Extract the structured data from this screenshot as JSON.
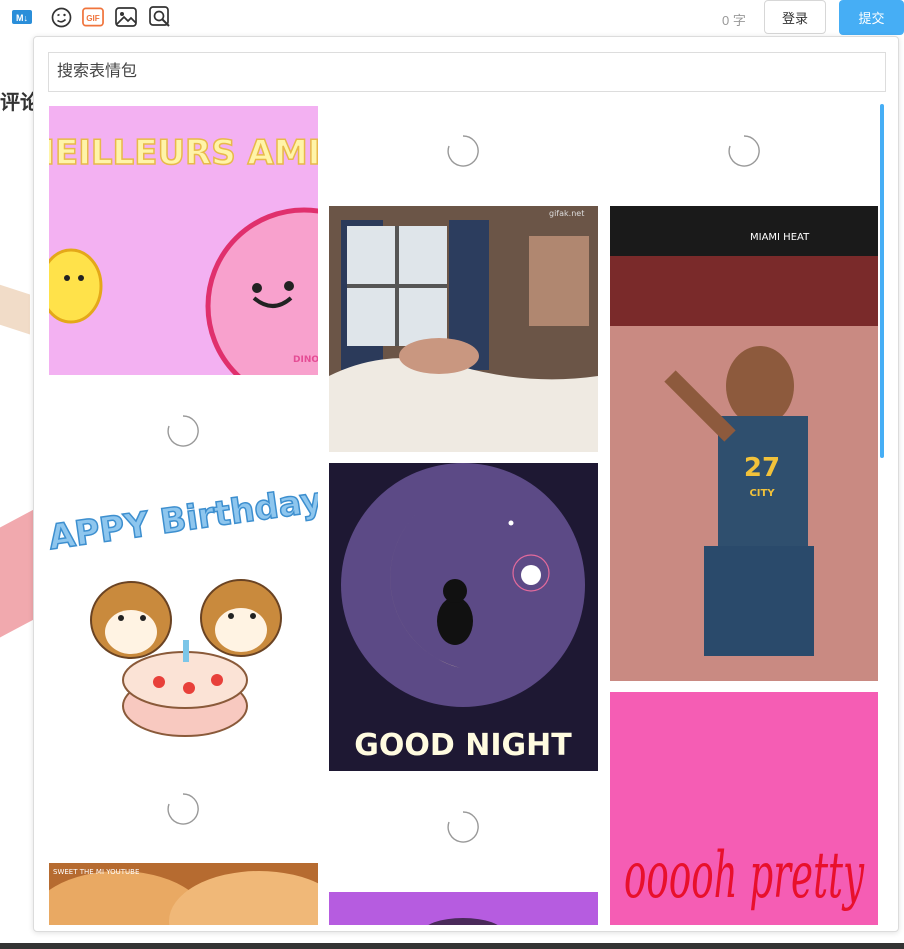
{
  "page": {
    "comment_heading": "评论"
  },
  "toolbar": {
    "icons": [
      "markdown-icon",
      "emoji-icon",
      "gif-icon",
      "image-icon",
      "search-image-icon"
    ],
    "word_count": "0",
    "word_unit": "字",
    "login_label": "登录",
    "submit_label": "提交",
    "gif_label": "GIF",
    "md_label": "M↓"
  },
  "gif_panel": {
    "search_placeholder": "搜索表情包",
    "gifs": [
      {
        "title": "MEILLEURS AMIS",
        "brand": "DINO SALLY"
      },
      {
        "title": "",
        "watermark": "gifak.net"
      },
      {
        "title": "",
        "scoreboard": "MIAMI HEAT",
        "jersey": "27",
        "jersey_team": "CITY"
      },
      {
        "title": "HAPPY Birthday"
      },
      {
        "title": "GOOD NIGHT"
      },
      {
        "title": "ooooh pretty"
      },
      {
        "title": "",
        "watermark": "SWEET THE MI YOUTUBE"
      },
      {
        "title": ""
      }
    ]
  },
  "colors": {
    "accent": "#46aef5",
    "border": "#dcdcdc"
  }
}
